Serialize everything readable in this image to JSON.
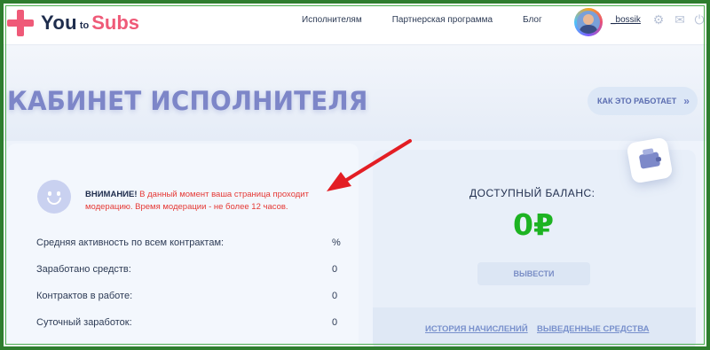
{
  "header": {
    "logo": {
      "part1": "You",
      "part2": "to",
      "part3": "Subs"
    },
    "nav": [
      "Исполнителям",
      "Партнерская программа",
      "Блог"
    ],
    "username": "_bossik",
    "icons": [
      "gear-icon",
      "mail-icon",
      "power-icon"
    ]
  },
  "hero": {
    "title": "КАБИНЕТ ИСПОЛНИТЕЛЯ",
    "how_button": "КАК ЭТО РАБОТАЕТ",
    "how_button_icon": "»"
  },
  "notice": {
    "label": "ВНИМАНИЕ!",
    "text": " В данный момент ваша страница проходит модерацию. Время модерации - не более 12 часов."
  },
  "stats": [
    {
      "label": "Средняя активность по всем контрактам:",
      "value": "%"
    },
    {
      "label": "Заработано средств:",
      "value": "0"
    },
    {
      "label": "Контрактов в работе:",
      "value": "0"
    },
    {
      "label": "Суточный заработок:",
      "value": "0"
    }
  ],
  "balance": {
    "title": "ДОСТУПНЫЙ БАЛАНС:",
    "amount": "0₽",
    "withdraw_button": "ВЫВЕСТИ",
    "links": [
      "ИСТОРИЯ НАЧИСЛЕНИЙ",
      "ВЫВЕДЕННЫЕ СРЕДСТВА"
    ]
  },
  "colors": {
    "brand_pink": "#ef5a78",
    "brand_navy": "#1f2d4d",
    "warning_red": "#e53935",
    "balance_green": "#1db322",
    "arrow_red": "#e31e24",
    "frame_green": "#2e7d2e"
  }
}
